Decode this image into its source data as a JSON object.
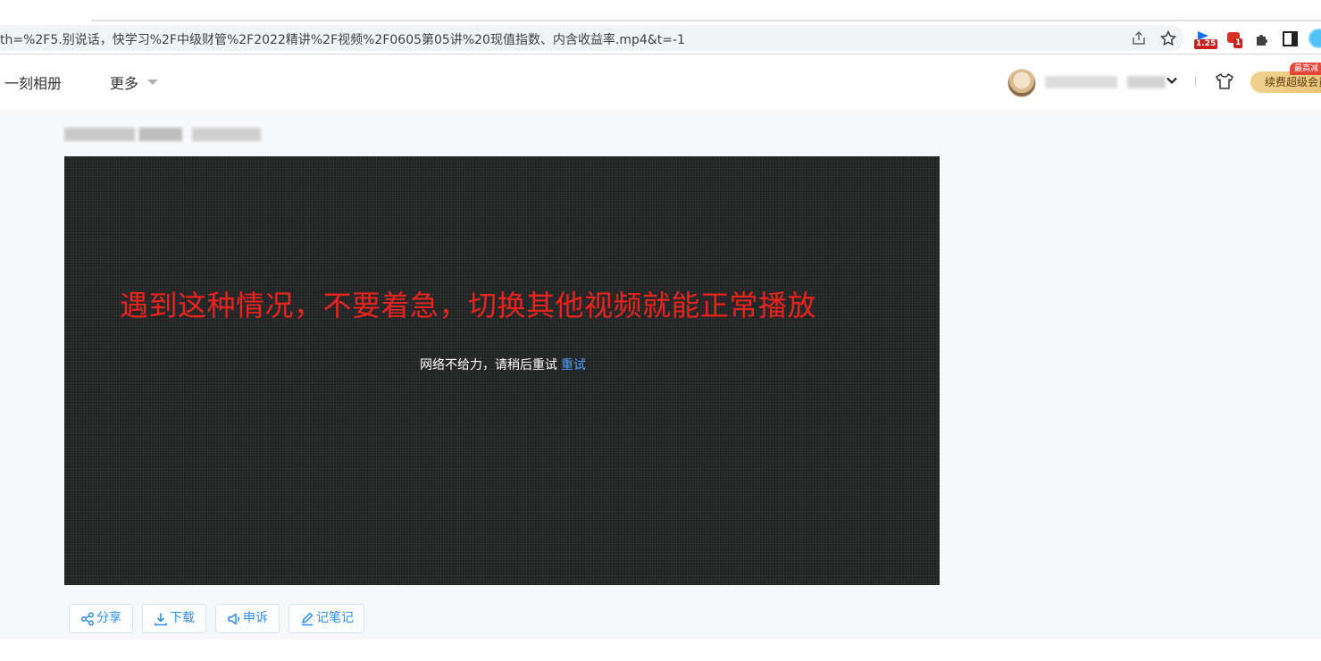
{
  "browser": {
    "url": "th=%2F5.别说话，快学习%2F中级财管%2F2022精讲%2F视频%2F0605第05讲%20现值指数、内含收益率.mp4&t=-1",
    "extension_badge_speed": "1.25",
    "extension_badge_count": "1"
  },
  "header": {
    "nav_items": [
      "一刻相册",
      "更多"
    ],
    "vip_button": "续费超级会员",
    "vip_tag": "最高减"
  },
  "player": {
    "overlay_text": "遇到这种情况，不要着急，切换其他视频就能正常播放",
    "error_message": "网络不给力，请稍后重试",
    "retry_label": "重试"
  },
  "actions": {
    "share": "分享",
    "download": "下载",
    "report": "申诉",
    "notes": "记笔记"
  },
  "colors": {
    "accent": "#2d8cf0",
    "overlay_red": "#e8241c",
    "retry_blue": "#4aa3ff"
  }
}
